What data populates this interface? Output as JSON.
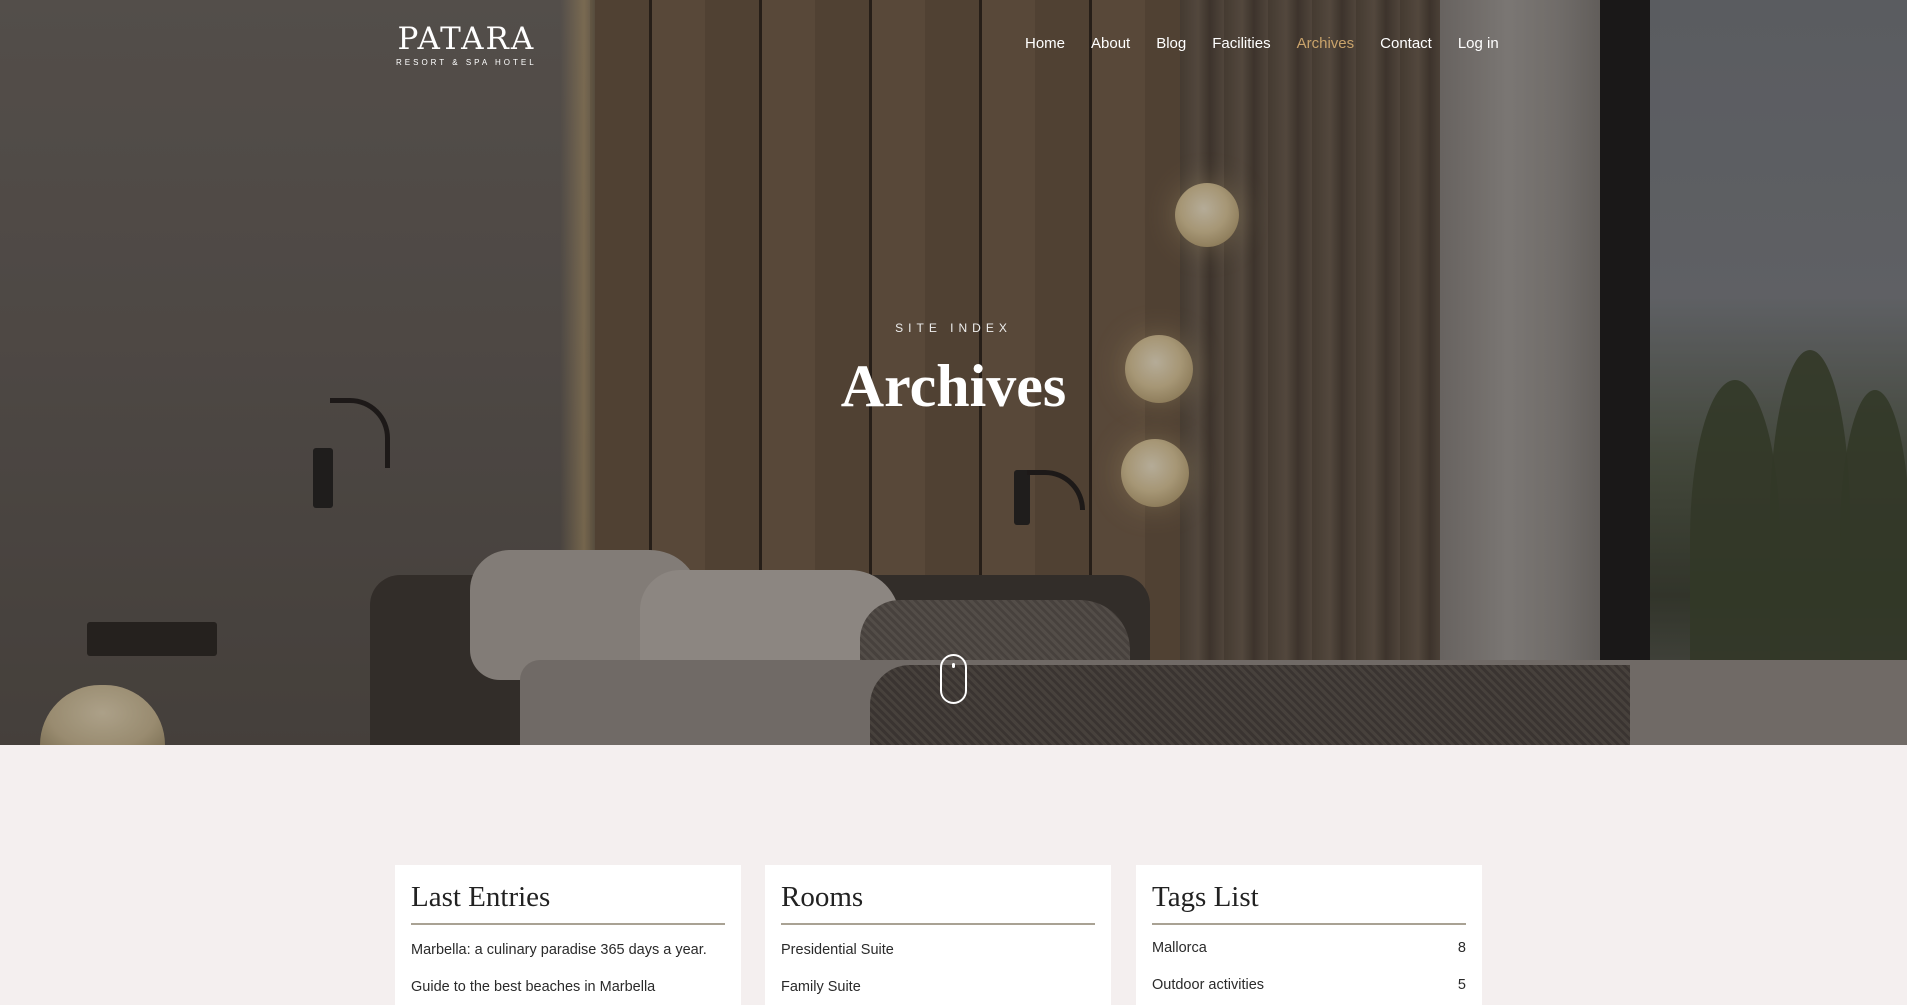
{
  "logo": {
    "name": "PATARA",
    "tagline": "RESORT & SPA HOTEL"
  },
  "nav": {
    "items": [
      {
        "label": "Home"
      },
      {
        "label": "About"
      },
      {
        "label": "Blog"
      },
      {
        "label": "Facilities"
      },
      {
        "label": "Archives"
      },
      {
        "label": "Contact"
      },
      {
        "label": "Log in"
      }
    ],
    "active": "Archives"
  },
  "hero": {
    "eyebrow": "SITE INDEX",
    "title": "Archives"
  },
  "last_entries": {
    "title": "Last Entries",
    "items": [
      {
        "label": "Marbella: a culinary paradise 365 days a year."
      },
      {
        "label": "Guide to the best beaches in Marbella"
      }
    ]
  },
  "rooms": {
    "title": "Rooms",
    "items": [
      {
        "label": "Presidential Suite"
      },
      {
        "label": "Family Suite"
      }
    ]
  },
  "tags": {
    "title": "Tags List",
    "items": [
      {
        "label": "Mallorca",
        "count": "8"
      },
      {
        "label": "Outdoor activities",
        "count": "5"
      }
    ]
  },
  "colors": {
    "accent": "#c9a36b",
    "background": "#f4efef",
    "divider": "#a9a294"
  }
}
